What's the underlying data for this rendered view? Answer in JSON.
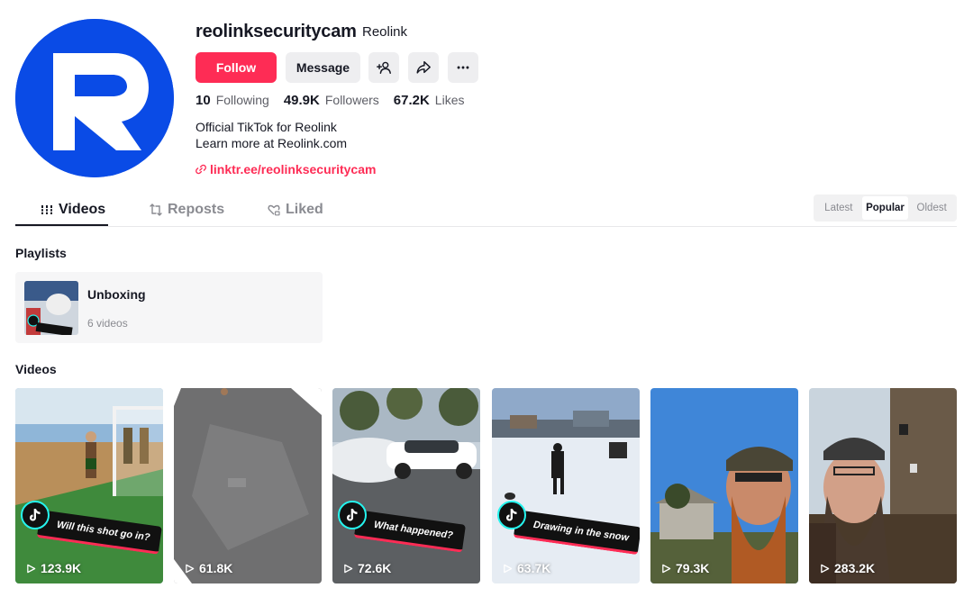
{
  "profile": {
    "username": "reolinksecuritycam",
    "nickname": "Reolink",
    "follow_label": "Follow",
    "message_label": "Message",
    "stats": {
      "following_count": "10",
      "following_label": "Following",
      "followers_count": "49.9K",
      "followers_label": "Followers",
      "likes_count": "67.2K",
      "likes_label": "Likes"
    },
    "bio": [
      "Official TikTok for Reolink",
      "Learn more at Reolink.com"
    ],
    "link": "linktr.ee/reolinksecuritycam",
    "brand_color": "#0a4be6"
  },
  "tabs": {
    "videos": "Videos",
    "reposts": "Reposts",
    "liked": "Liked",
    "active": "Videos"
  },
  "sort": {
    "options": [
      "Latest",
      "Popular",
      "Oldest"
    ],
    "selected": "Popular"
  },
  "playlists": {
    "title": "Playlists",
    "items": [
      {
        "name": "Unboxing",
        "count": "6 videos"
      }
    ]
  },
  "videos": {
    "title": "Videos",
    "items": [
      {
        "views": "123.9K",
        "caption": "Will this shot go in?"
      },
      {
        "views": "61.8K",
        "caption": ""
      },
      {
        "views": "72.6K",
        "caption": "What happened?"
      },
      {
        "views": "63.7K",
        "caption": "Drawing in the snow"
      },
      {
        "views": "79.3K",
        "caption": ""
      },
      {
        "views": "283.2K",
        "caption": ""
      }
    ]
  },
  "colors": {
    "accent": "#fe2c55",
    "text": "#161823",
    "muted": "#8a8b91"
  }
}
